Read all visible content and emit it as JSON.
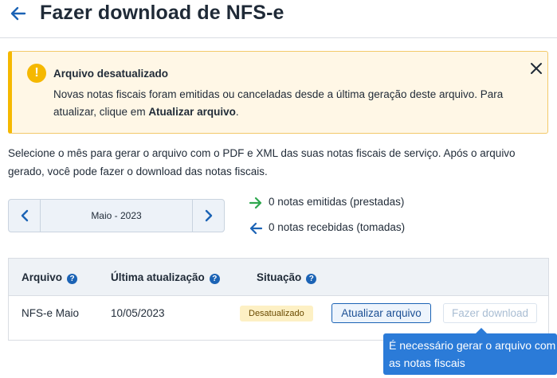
{
  "header": {
    "title": "Fazer download de NFS-e",
    "back_icon": "arrow-left-icon"
  },
  "alert": {
    "icon": "exclamation-icon",
    "title": "Arquivo desatualizado",
    "body_prefix": "Novas notas fiscais foram emitidas ou canceladas desde a última geração deste arquivo. Para atualizar, clique em ",
    "body_bold": "Atualizar arquivo",
    "body_suffix": ".",
    "close_icon": "close-icon"
  },
  "intro": {
    "text": "Selecione o mês para gerar o arquivo com o PDF e XML das suas notas fiscais de serviço. Após o arquivo gerado, você pode fazer o download das notas fiscais."
  },
  "month_picker": {
    "label": "Maio - 2023",
    "prev_icon": "chevron-left-icon",
    "next_icon": "chevron-right-icon"
  },
  "stats": {
    "issued": {
      "text": "0 notas emitidas (prestadas)",
      "icon": "arrow-right-icon",
      "color": "#2fa84f"
    },
    "received": {
      "text": "0 notas recebidas (tomadas)",
      "icon": "arrow-left-icon",
      "color": "#1b63b5"
    }
  },
  "table": {
    "headers": {
      "file": "Arquivo",
      "last_update": "Última atualização",
      "status": "Situação"
    },
    "row": {
      "file": "NFS-e Maio",
      "last_update": "10/05/2023",
      "status": "Desatualizado",
      "update_button": "Atualizar arquivo",
      "download_button": "Fazer download"
    }
  },
  "tooltip": {
    "text": "É necessário gerar o arquivo com as notas fiscais"
  },
  "colors": {
    "accent": "#1b63b5",
    "warning": "#f5b800",
    "tooltip_bg": "#2b7bd8"
  }
}
